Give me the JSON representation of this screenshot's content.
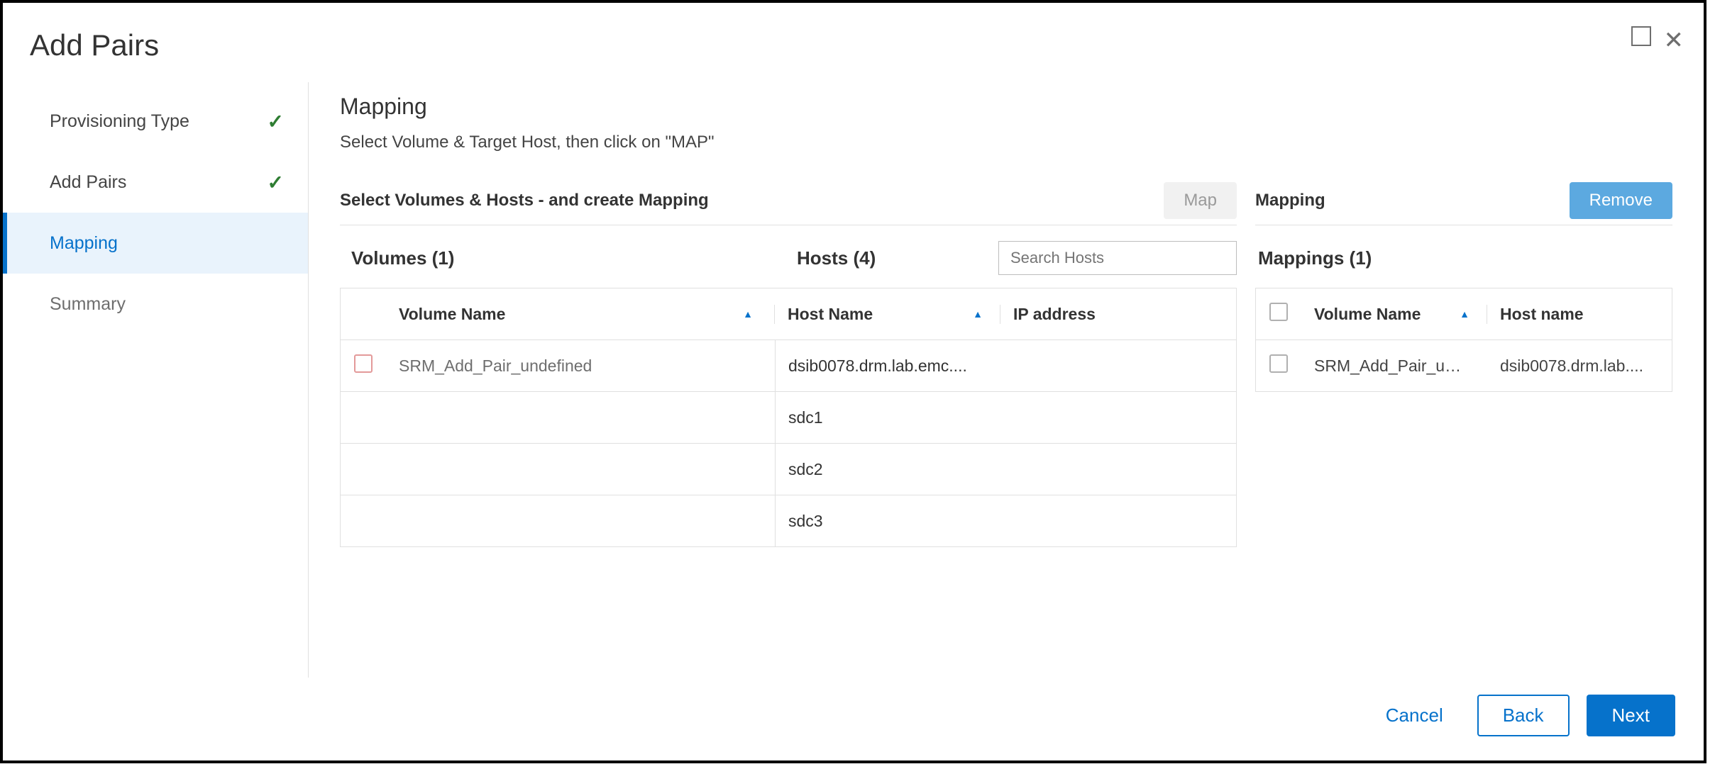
{
  "dialog": {
    "title": "Add Pairs"
  },
  "sidebar": {
    "steps": [
      {
        "label": "Provisioning Type",
        "state": "done"
      },
      {
        "label": "Add Pairs",
        "state": "done"
      },
      {
        "label": "Mapping",
        "state": "active"
      },
      {
        "label": "Summary",
        "state": "pending"
      }
    ]
  },
  "main": {
    "title": "Mapping",
    "subtitle": "Select Volume & Target Host, then click on \"MAP\"",
    "left_section_label": "Select Volumes & Hosts - and create Mapping",
    "right_section_label": "Mapping",
    "map_button": "Map",
    "remove_button": "Remove",
    "volumes_header": "Volumes (1)",
    "hosts_header": "Hosts (4)",
    "mappings_header": "Mappings (1)",
    "search_placeholder": "Search Hosts",
    "columns": {
      "volume_name": "Volume Name",
      "host_name": "Host Name",
      "ip_address": "IP address",
      "m_volume_name": "Volume Name",
      "m_host_name": "Host name"
    },
    "volumes": [
      {
        "name": "SRM_Add_Pair_undefined"
      }
    ],
    "hosts": [
      {
        "name": "dsib0078.drm.lab.emc....",
        "ip": ""
      },
      {
        "name": "sdc1",
        "ip": ""
      },
      {
        "name": "sdc2",
        "ip": ""
      },
      {
        "name": "sdc3",
        "ip": ""
      }
    ],
    "mappings": [
      {
        "volume": "SRM_Add_Pair_u…",
        "host": "dsib0078.drm.lab...."
      }
    ]
  },
  "footer": {
    "cancel": "Cancel",
    "back": "Back",
    "next": "Next"
  }
}
